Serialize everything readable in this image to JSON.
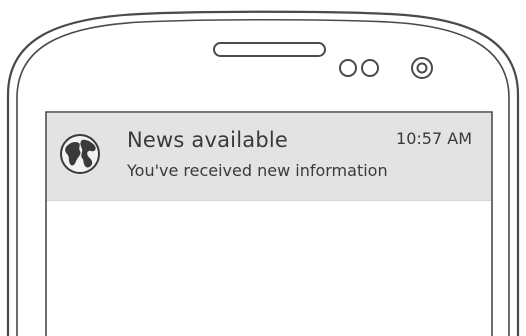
{
  "notification": {
    "icon": "globe-icon",
    "title": "News available",
    "text": "You've received new information",
    "time": "10:57 AM"
  },
  "colors": {
    "notification_background": "#e3e3e3",
    "text": "#3a3a3a",
    "phone_outline": "#4a4a4a"
  }
}
